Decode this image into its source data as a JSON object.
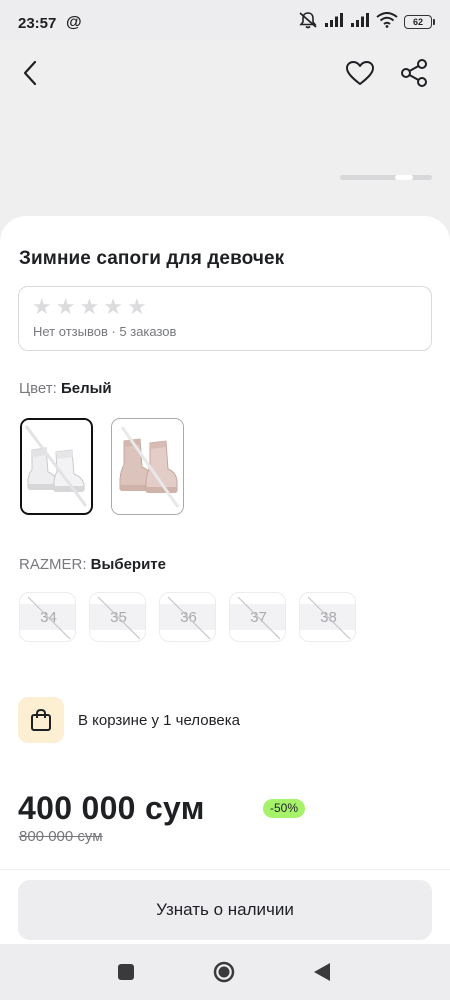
{
  "status_bar": {
    "time": "23:57",
    "at_symbol": "@",
    "battery": "62",
    "icons": [
      "mute-icon",
      "signal-icon",
      "signal-icon",
      "wifi-icon",
      "battery-icon"
    ]
  },
  "header": {
    "icons": [
      "back-arrow-icon",
      "heart-icon",
      "share-icon"
    ]
  },
  "product": {
    "title": "Зимние сапоги для девочек",
    "rating": {
      "stars_filled": 0,
      "stars_total": 5,
      "summary": "Нет отзывов · 5 заказов"
    }
  },
  "color": {
    "label": "Цвет:",
    "value": "Белый",
    "options": [
      {
        "name": "Белый",
        "selected": true
      },
      {
        "name": "Розовый",
        "selected": false
      }
    ]
  },
  "size": {
    "label": "RAZMER:",
    "value": "Выберите",
    "options": [
      "34",
      "35",
      "36",
      "37",
      "38"
    ]
  },
  "cart_info": {
    "text": "В корзине у 1 человека",
    "icon": "shopping-bag-icon"
  },
  "pricing": {
    "price": "400 000 сум",
    "discount": "-50%",
    "old_price": "800 000 сум"
  },
  "action": {
    "button_label": "Узнать о наличии"
  },
  "colors": {
    "discount_badge": "#a6f26b",
    "bag_icon_bg": "#fdf0d2",
    "button_bg": "#ededf0"
  }
}
